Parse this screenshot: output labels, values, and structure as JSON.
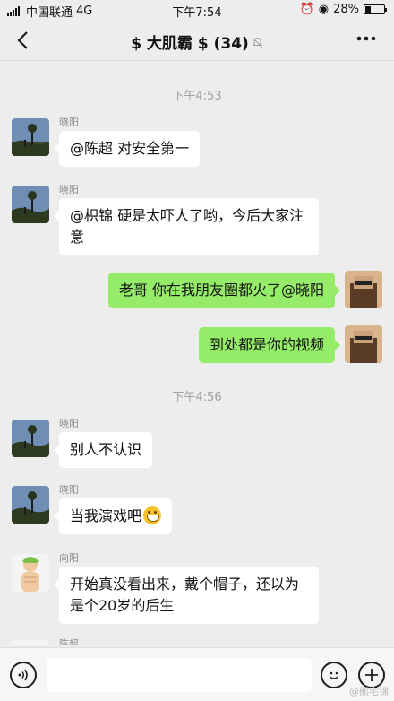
{
  "status_bar": {
    "carrier": "中国联通",
    "network": "4G",
    "time": "下午7:54",
    "battery": "28%",
    "battery_level": 0.28
  },
  "header": {
    "title": "$ 大肌霸 $ (34)",
    "back_icon": "chevron-left-icon",
    "mute_icon": "bell-muted-icon",
    "more_icon": "more-dots-icon"
  },
  "chat": {
    "timestamps": [
      "下午4:53",
      "下午4:56"
    ],
    "messages": [
      {
        "sender": "晓阳",
        "text": "@陈超 对安全第一",
        "side": "left"
      },
      {
        "sender": "晓阳",
        "text": "@枳锦 硬是太吓人了哟，今后大家注意",
        "side": "left"
      },
      {
        "sender": "",
        "text": "老哥 你在我朋友圈都火了@晓阳",
        "side": "right"
      },
      {
        "sender": "",
        "text": "到处都是你的视频",
        "side": "right"
      },
      {
        "sender": "晓阳",
        "text": "别人不认识",
        "side": "left"
      },
      {
        "sender": "晓阳",
        "text": "当我演戏吧",
        "side": "left",
        "emoji": "grin-emoji"
      },
      {
        "sender": "向阳",
        "text": "开始真没看出来，戴个帽子，还以为是个20岁的后生",
        "side": "left"
      },
      {
        "sender": "陈超",
        "text": "",
        "side": "left"
      }
    ]
  },
  "input_bar": {
    "voice_icon": "voice-icon",
    "emoji_icon": "emoji-icon",
    "plus_icon": "plus-icon",
    "value": ""
  },
  "watermark": "@熊宅锦",
  "colors": {
    "bubble_self": "#95ec69",
    "bubble_other": "#ffffff",
    "background": "#ededed"
  }
}
